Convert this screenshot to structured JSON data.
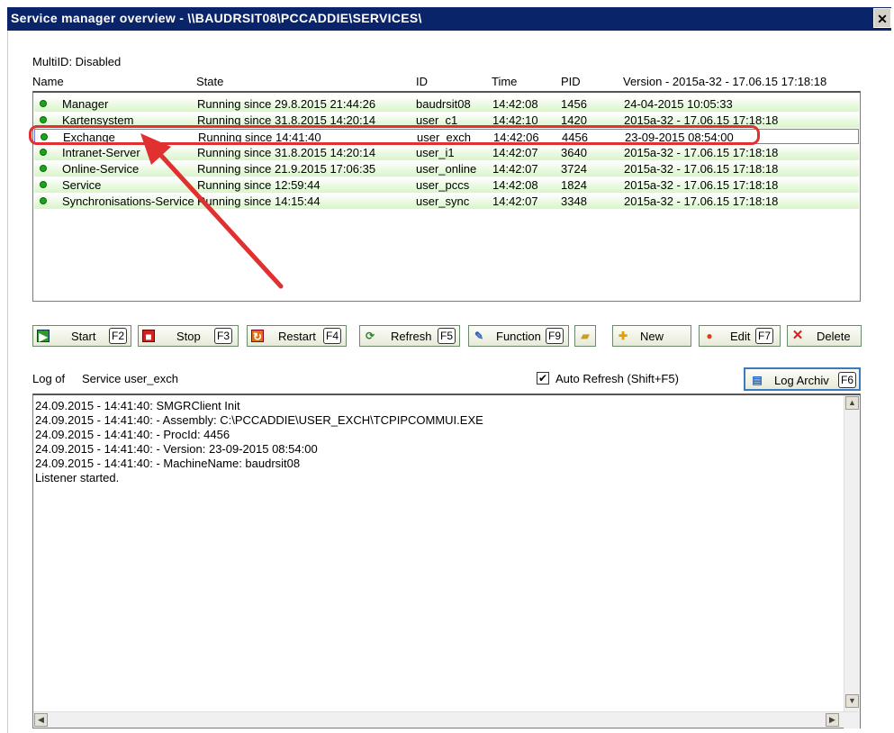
{
  "window": {
    "title": "Service manager overview - \\\\BAUDRSIT08\\PCCADDIE\\SERVICES\\"
  },
  "multiid": "MultiID: Disabled",
  "columns": {
    "name": "Name",
    "state": "State",
    "id": "ID",
    "time": "Time",
    "pid": "PID",
    "version": "Version - 2015a-32 - 17.06.15 17:18:18"
  },
  "services": [
    {
      "name": "Manager",
      "state": "Running since 29.8.2015 21:44:26",
      "id": "baudrsit08",
      "time": "14:42:08",
      "pid": "1456",
      "version": "24-04-2015 10:05:33"
    },
    {
      "name": "Kartensystem",
      "state": "Running since 31.8.2015 14:20:14",
      "id": "user_c1",
      "time": "14:42:10",
      "pid": "1420",
      "version": "2015a-32 - 17.06.15 17:18:18"
    },
    {
      "name": "Exchange",
      "state": "Running since 14:41:40",
      "id": "user_exch",
      "time": "14:42:06",
      "pid": "4456",
      "version": "23-09-2015 08:54:00"
    },
    {
      "name": "Intranet-Server",
      "state": "Running since 31.8.2015 14:20:14",
      "id": "user_i1",
      "time": "14:42:07",
      "pid": "3640",
      "version": "2015a-32 - 17.06.15 17:18:18"
    },
    {
      "name": "Online-Service",
      "state": "Running since 21.9.2015 17:06:35",
      "id": "user_online",
      "time": "14:42:07",
      "pid": "3724",
      "version": "2015a-32 - 17.06.15 17:18:18"
    },
    {
      "name": "Service",
      "state": "Running since 12:59:44",
      "id": "user_pccs",
      "time": "14:42:08",
      "pid": "1824",
      "version": "2015a-32 - 17.06.15 17:18:18"
    },
    {
      "name": "Synchronisations-Service",
      "state": "Running since 14:15:44",
      "id": "user_sync",
      "time": "14:42:07",
      "pid": "3348",
      "version": "2015a-32 - 17.06.15 17:18:18"
    }
  ],
  "buttons": {
    "start": {
      "label": "Start",
      "key": "F2"
    },
    "stop": {
      "label": "Stop",
      "key": "F3"
    },
    "restart": {
      "label": "Restart",
      "key": "F4"
    },
    "refresh": {
      "label": "Refresh",
      "key": "F5"
    },
    "function": {
      "label": "Function",
      "key": "F9"
    },
    "new": {
      "label": "New"
    },
    "edit": {
      "label": "Edit",
      "key": "F7"
    },
    "delete": {
      "label": "Delete"
    },
    "logarchiv": {
      "label": "Log Archiv",
      "key": "F6"
    }
  },
  "log": {
    "label": "Log of",
    "service": "Service user_exch",
    "auto_refresh": "Auto Refresh (Shift+F5)",
    "auto_refresh_checked": true,
    "lines": [
      "24.09.2015 - 14:41:40: SMGRClient Init",
      "24.09.2015 - 14:41:40: - Assembly: C:\\PCCADDIE\\USER_EXCH\\TCPIPCOMMUI.EXE",
      "24.09.2015 - 14:41:40: - ProcId: 4456",
      "24.09.2015 - 14:41:40: - Version: 23-09-2015 08:54:00",
      "24.09.2015 - 14:41:40: - MachineName: baudrsit08",
      "Listener started."
    ]
  },
  "colors": {
    "titlebar": "#0a246a",
    "running": "#1aa51a",
    "annotation": "#e03030",
    "row_tint": "#d8f5c8"
  },
  "icons": {
    "close": "close-icon",
    "status": "green-dot-icon"
  }
}
